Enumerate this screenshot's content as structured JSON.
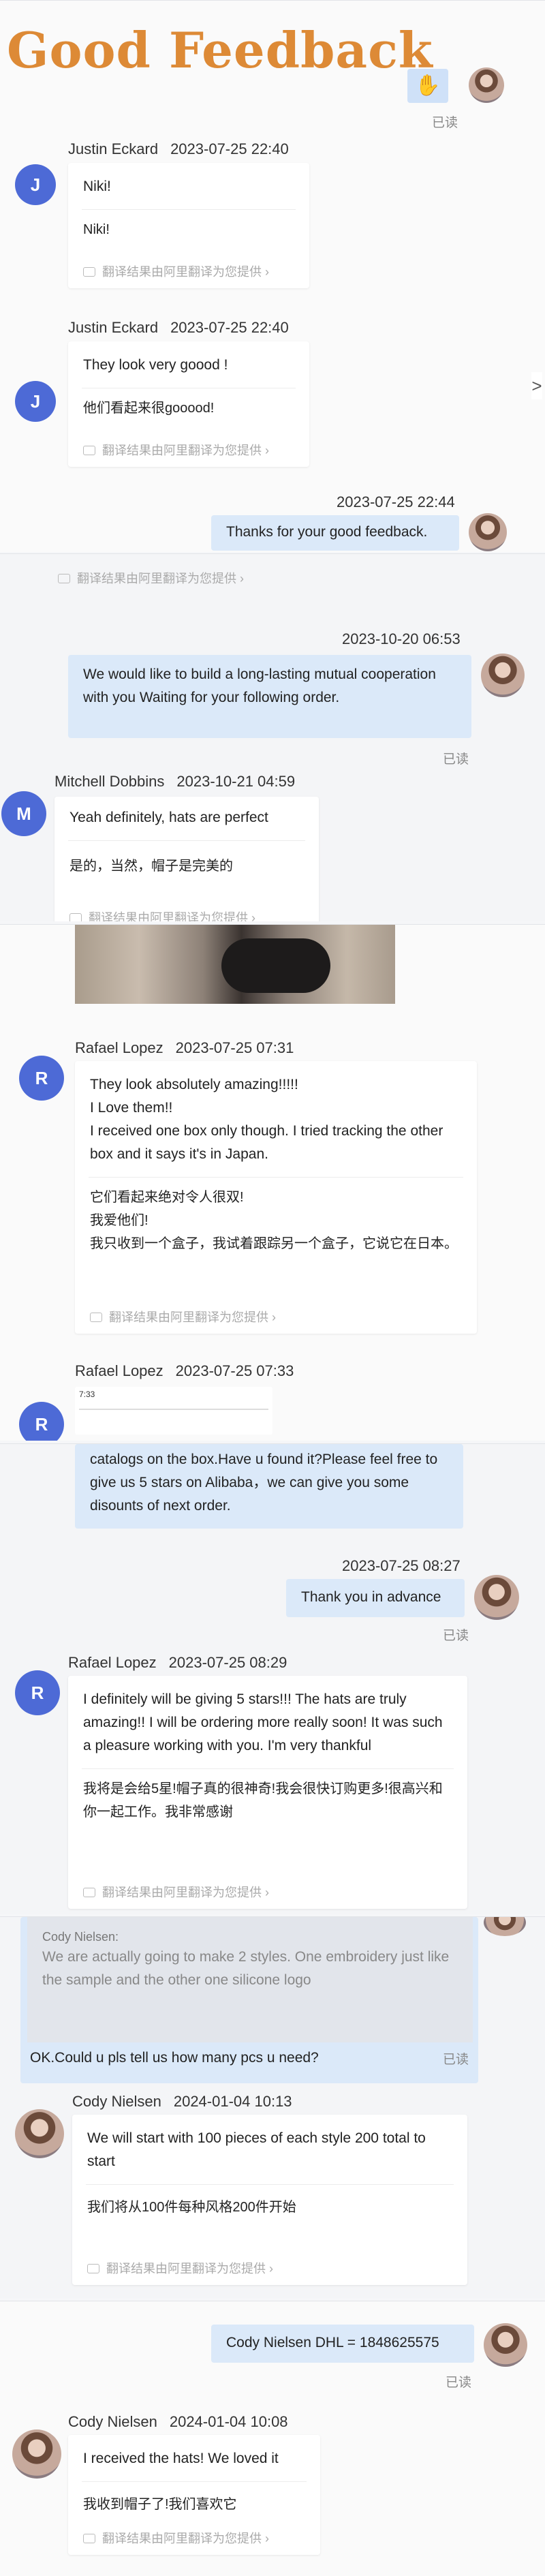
{
  "title": "Good Feedback",
  "translation_note": "翻译结果由阿里翻译为您提供",
  "read_label": "已读",
  "nav_arrow": ">",
  "p1": {
    "c1": {
      "avatar_letter": "J",
      "sender": "Justin Eckard",
      "time": "2023-07-25 22:40",
      "text": "Niki!",
      "translation": "Niki!"
    },
    "c2": {
      "avatar_letter": "J",
      "sender": "Justin Eckard",
      "time": "2023-07-25 22:40",
      "text": "They look very goood !",
      "translation": "他们看起来很gooood!"
    },
    "out_time": "2023-07-25 22:44",
    "out_text": "Thanks for your good feedback."
  },
  "p2": {
    "out_time": "2023-10-20 06:53",
    "out_text": "We would like to build a long-lasting mutual cooperation with you Waiting for your following order.",
    "in": {
      "avatar_letter": "M",
      "sender": "Mitchell Dobbins",
      "time": "2023-10-21 04:59",
      "text": "Yeah definitely, hats are perfect",
      "translation": "是的，当然，帽子是完美的"
    }
  },
  "p3": {
    "c1": {
      "avatar_letter": "R",
      "sender": "Rafael Lopez",
      "time": "2023-07-25 07:31",
      "text": "They look absolutely amazing!!!!!\nI Love them!!\nI received one box only though. I tried tracking the other box and it says it's in Japan.",
      "translation": "它们看起来绝对令人很双!\n我爱他们!\n我只收到一个盒子，我试着跟踪另一个盒子，它说它在日本。"
    },
    "c2": {
      "avatar_letter": "R",
      "sender": "Rafael Lopez",
      "time": "2023-07-25 07:33",
      "phone_time": "7:33"
    }
  },
  "p4": {
    "top_text": "catalogs on the box.Have u found it?Please feel free to give us 5 stars on Alibaba，we can give you some disounts of next order.",
    "out_time": "2023-07-25 08:27",
    "out_text": "Thank you in advance",
    "in": {
      "avatar_letter": "R",
      "sender": "Rafael Lopez",
      "time": "2023-07-25 08:29",
      "text": "I definitely will be giving 5 stars!!! The hats are truly amazing!! I will be ordering more really soon! It was such a pleasure working with you. I'm very thankful",
      "translation": "我将是会给5星!帽子真的很神奇!我会很快订购更多!很高兴和你一起工作。我非常感谢"
    }
  },
  "p5": {
    "quote_name": "Cody Nielsen:",
    "quote_text": "We are actually going to make 2 styles. One embroidery just like the sample and the other one silicone logo",
    "out_text": "OK.Could u pls tell us how many pcs u need?",
    "in": {
      "sender": "Cody Nielsen",
      "time": "2024-01-04 10:13",
      "text": "We will start with 100 pieces of each style 200 total to start",
      "translation": "我们将从100件每种风格200件开始"
    }
  },
  "p6": {
    "out_text": "Cody Nielsen DHL = 1848625575",
    "in": {
      "sender": "Cody Nielsen",
      "time": "2024-01-04 10:08",
      "text": "I received the hats! We loved it",
      "translation": "我收到帽子了!我们喜欢它"
    }
  },
  "colors": {
    "title": "#dd8a36",
    "avatar": "#4d6ad6",
    "outgoing_bubble": "#dbe9f9"
  }
}
